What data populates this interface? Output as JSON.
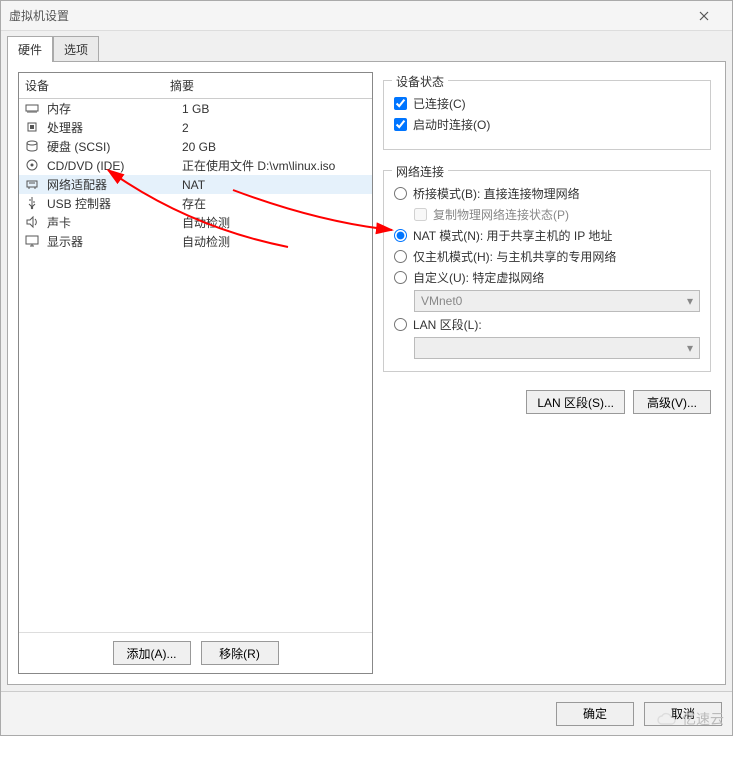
{
  "titlebar": {
    "title": "虚拟机设置"
  },
  "tabs": {
    "hardware": "硬件",
    "options": "选项"
  },
  "headers": {
    "device": "设备",
    "summary": "摘要"
  },
  "devices": [
    {
      "name": "内存",
      "summary": "1 GB",
      "icon": "memory-icon"
    },
    {
      "name": "处理器",
      "summary": "2",
      "icon": "cpu-icon"
    },
    {
      "name": "硬盘 (SCSI)",
      "summary": "20 GB",
      "icon": "disk-icon"
    },
    {
      "name": "CD/DVD (IDE)",
      "summary": "正在使用文件 D:\\vm\\linux.iso",
      "icon": "cd-icon"
    },
    {
      "name": "网络适配器",
      "summary": "NAT",
      "icon": "nic-icon"
    },
    {
      "name": "USB 控制器",
      "summary": "存在",
      "icon": "usb-icon"
    },
    {
      "name": "声卡",
      "summary": "自动检测",
      "icon": "sound-icon"
    },
    {
      "name": "显示器",
      "summary": "自动检测",
      "icon": "display-icon"
    }
  ],
  "selected_index": 4,
  "left_buttons": {
    "add": "添加(A)...",
    "remove": "移除(R)"
  },
  "right": {
    "status_group": {
      "title": "设备状态",
      "connected": "已连接(C)",
      "connect_at_poweron": "启动时连接(O)"
    },
    "net_group": {
      "title": "网络连接",
      "bridged": "桥接模式(B): 直接连接物理网络",
      "replicate": "复制物理网络连接状态(P)",
      "nat": "NAT 模式(N): 用于共享主机的 IP 地址",
      "hostonly": "仅主机模式(H): 与主机共享的专用网络",
      "custom": "自定义(U): 特定虚拟网络",
      "custom_value": "VMnet0",
      "lan": "LAN 区段(L):",
      "lan_value": ""
    },
    "buttons": {
      "lan_seg": "LAN 区段(S)...",
      "advanced": "高级(V)..."
    }
  },
  "bottom": {
    "ok": "确定",
    "cancel": "取消"
  },
  "watermark": "亿速云"
}
